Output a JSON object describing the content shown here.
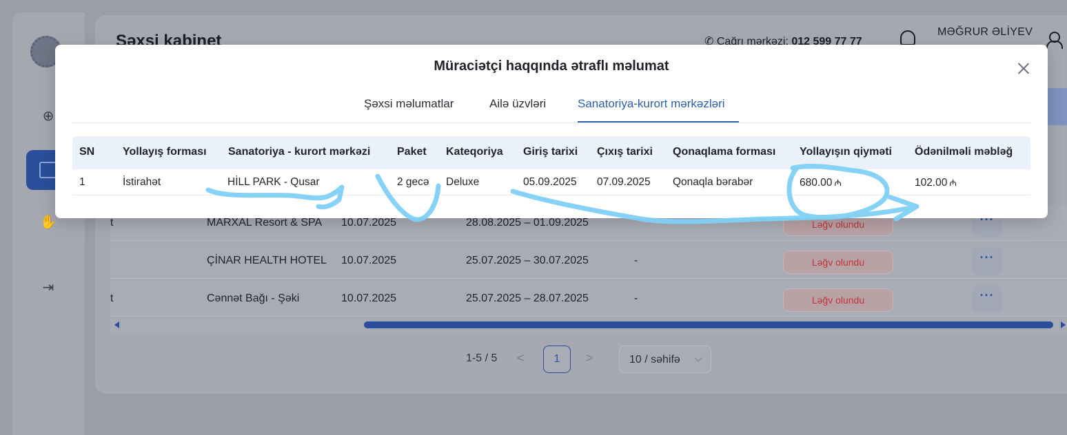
{
  "header": {
    "page_title": "Şəxsi kabinet",
    "call_center_label": "Çağrı mərkəzi:",
    "call_center_number": "012 599 77 77",
    "user_name": "MƏĞRUR ƏLİYEV"
  },
  "background_table": {
    "rows": [
      {
        "col_a": "t",
        "hotel": "MARXAL Resort & SPA",
        "date": "10.07.2025",
        "period": "28.08.2025 – 01.09.2025",
        "note": "",
        "status": "Ləğv olundu",
        "actions": "···"
      },
      {
        "col_a": "",
        "hotel": "ÇİNAR HEALTH HOTEL",
        "date": "10.07.2025",
        "period": "25.07.2025 – 30.07.2025",
        "note": "-",
        "status": "Ləğv olundu",
        "actions": "···"
      },
      {
        "col_a": "t",
        "hotel": "Cənnət Bağı - Şəki",
        "date": "10.07.2025",
        "period": "25.07.2025 – 28.07.2025",
        "note": "-",
        "status": "Ləğv olundu",
        "actions": "···"
      }
    ]
  },
  "pagination": {
    "range": "1-5 / 5",
    "prev": "<",
    "current_page": "1",
    "next": ">",
    "page_size": "10 / səhifə"
  },
  "modal": {
    "title": "Müraciətçi haqqında ətraflı məlumat",
    "close": "×",
    "tabs": [
      {
        "label": "Şəxsi məlumatlar",
        "active": false
      },
      {
        "label": "Ailə üzvləri",
        "active": false
      },
      {
        "label": "Sanatoriya-kurort mərkəzləri",
        "active": true
      }
    ],
    "table": {
      "headers": [
        "SN",
        "Yollayış forması",
        "Sanatoriya - kurort mərkəzi",
        "Paket",
        "Kateqoriya",
        "Giriş tarixi",
        "Çıxış tarixi",
        "Qonaqlama forması",
        "Yollayışın qiyməti",
        "Ödənilməli məbləğ"
      ],
      "rows": [
        [
          "1",
          "İstirahət",
          "HİLL PARK - Qusar",
          "2 gecə",
          "Deluxe",
          "05.09.2025",
          "07.09.2025",
          "Qonaqla bərabər",
          "680.00",
          "102.00"
        ]
      ],
      "currency_symbol": "₼"
    }
  },
  "colors": {
    "accent": "#2c5fa8",
    "table_header_bg": "#eaf1fb",
    "scribble": "#7fd0f5",
    "status_red": "#c0343a"
  }
}
